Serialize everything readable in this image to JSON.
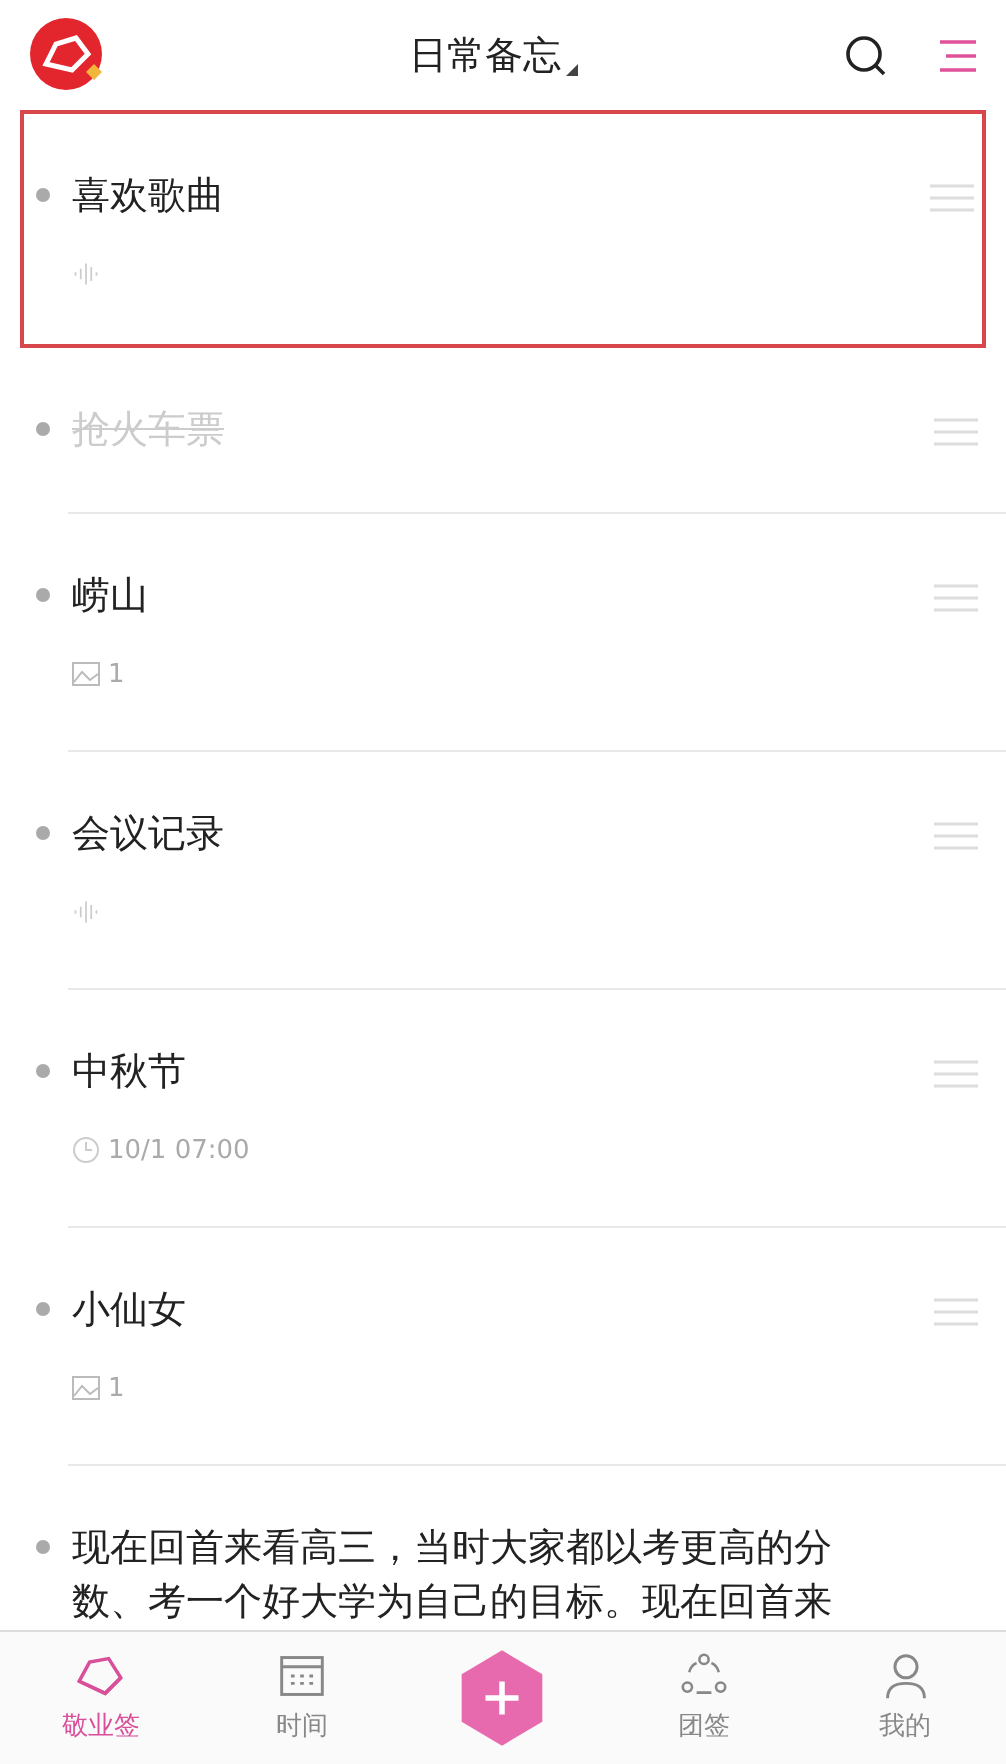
{
  "header": {
    "title": "日常备忘"
  },
  "notes": [
    {
      "title": "喜欢歌曲",
      "done": false,
      "selected": true,
      "kind": "audio"
    },
    {
      "title": "抢火车票",
      "done": true,
      "selected": false,
      "kind": "plain"
    },
    {
      "title": "崂山",
      "done": false,
      "selected": false,
      "kind": "image",
      "meta": "1"
    },
    {
      "title": "会议记录",
      "done": false,
      "selected": false,
      "kind": "audio"
    },
    {
      "title": "中秋节",
      "done": false,
      "selected": false,
      "kind": "time",
      "meta": "10/1 07:00"
    },
    {
      "title": "小仙女",
      "done": false,
      "selected": false,
      "kind": "image",
      "meta": "1"
    },
    {
      "title": "现在回首来看高三，当时大家都以考更高的分数、考一个好大学为自己的目标。现在回首来",
      "done": false,
      "selected": false,
      "kind": "plain"
    }
  ],
  "tabs": [
    {
      "label": "敬业签",
      "kind": "logo",
      "selected": true
    },
    {
      "label": "时间",
      "kind": "calendar",
      "selected": false
    },
    {
      "kind": "add",
      "selected": false
    },
    {
      "label": "团签",
      "kind": "team",
      "selected": false
    },
    {
      "label": "我的",
      "kind": "person",
      "selected": false
    }
  ]
}
